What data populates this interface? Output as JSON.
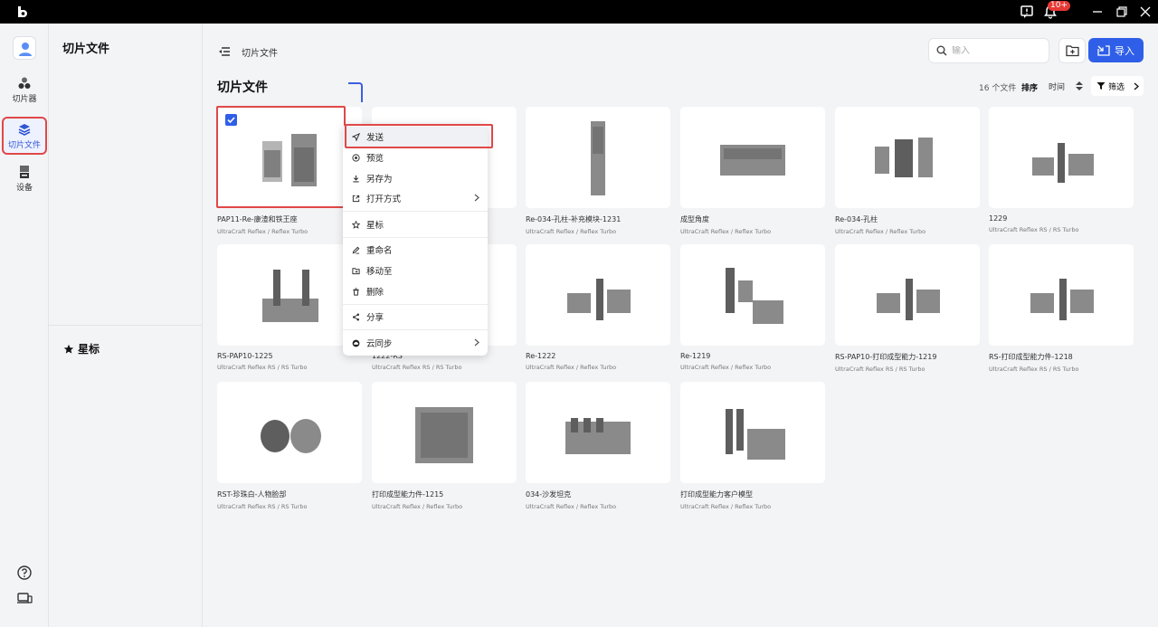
{
  "titlebar": {
    "notifications_badge": "10+"
  },
  "rail": {
    "items": [
      {
        "label": "切片器",
        "icon": "slicer-icon"
      },
      {
        "label": "切片文件",
        "icon": "layers-icon",
        "active": true
      },
      {
        "label": "设备",
        "icon": "printer-icon"
      }
    ]
  },
  "panel": {
    "title": "切片文件",
    "starred_label": "星标"
  },
  "header": {
    "breadcrumb": "切片文件",
    "search_placeholder": "输入",
    "import_label": "导入"
  },
  "toolbar": {
    "section_title": "切片文件",
    "count_text": "16 个文件",
    "sort_label": "排序",
    "sort_value": "时间",
    "filter_label": "筛选"
  },
  "files": [
    {
      "name": "PAP11-Re-康渣和铁王座",
      "printer": "UltraCraft Reflex / Reflex Turbo",
      "selected": true
    },
    {
      "name": "",
      "printer": ""
    },
    {
      "name": "Re-034-孔柱-补充模块-1231",
      "printer": "UltraCraft Reflex / Reflex Turbo"
    },
    {
      "name": "成型角度",
      "printer": "UltraCraft Reflex / Reflex Turbo"
    },
    {
      "name": "Re-034-孔柱",
      "printer": "UltraCraft Reflex / Reflex Turbo"
    },
    {
      "name": "1229",
      "printer": "UltraCraft Reflex RS / RS Turbo"
    },
    {
      "name": "RS-PAP10-1225",
      "printer": "UltraCraft Reflex RS / RS Turbo"
    },
    {
      "name": "1222-RS",
      "printer": "UltraCraft Reflex RS / RS Turbo"
    },
    {
      "name": "Re-1222",
      "printer": "UltraCraft Reflex / Reflex Turbo"
    },
    {
      "name": "Re-1219",
      "printer": "UltraCraft Reflex / Reflex Turbo"
    },
    {
      "name": "RS-PAP10-打印成型能力-1219",
      "printer": "UltraCraft Reflex RS / RS Turbo"
    },
    {
      "name": "RS-打印成型能力件-1218",
      "printer": "UltraCraft Reflex RS / RS Turbo"
    },
    {
      "name": "RST-珍珠白-人物脸部",
      "printer": "UltraCraft Reflex RS / RS Turbo"
    },
    {
      "name": "打印成型能力件-1215",
      "printer": "UltraCraft Reflex / Reflex Turbo"
    },
    {
      "name": "034-沙发坦克",
      "printer": "UltraCraft Reflex / Reflex Turbo"
    },
    {
      "name": "打印成型能力客户模型",
      "printer": "UltraCraft Reflex / Reflex Turbo"
    }
  ],
  "context_menu": {
    "items": [
      {
        "label": "发送",
        "icon": "send-icon"
      },
      {
        "label": "预览",
        "icon": "preview-icon"
      },
      {
        "label": "另存为",
        "icon": "download-icon"
      },
      {
        "label": "打开方式",
        "icon": "open-with-icon",
        "submenu": true
      },
      {
        "label": "星标",
        "icon": "star-icon"
      },
      {
        "label": "重命名",
        "icon": "rename-icon"
      },
      {
        "label": "移动至",
        "icon": "move-icon"
      },
      {
        "label": "删除",
        "icon": "trash-icon"
      },
      {
        "label": "分享",
        "icon": "share-icon"
      },
      {
        "label": "云同步",
        "icon": "cloud-sync-icon",
        "submenu": true
      }
    ]
  },
  "colors": {
    "accent": "#2f5fe8",
    "highlight": "#e04848",
    "background": "#f3f4f6"
  }
}
